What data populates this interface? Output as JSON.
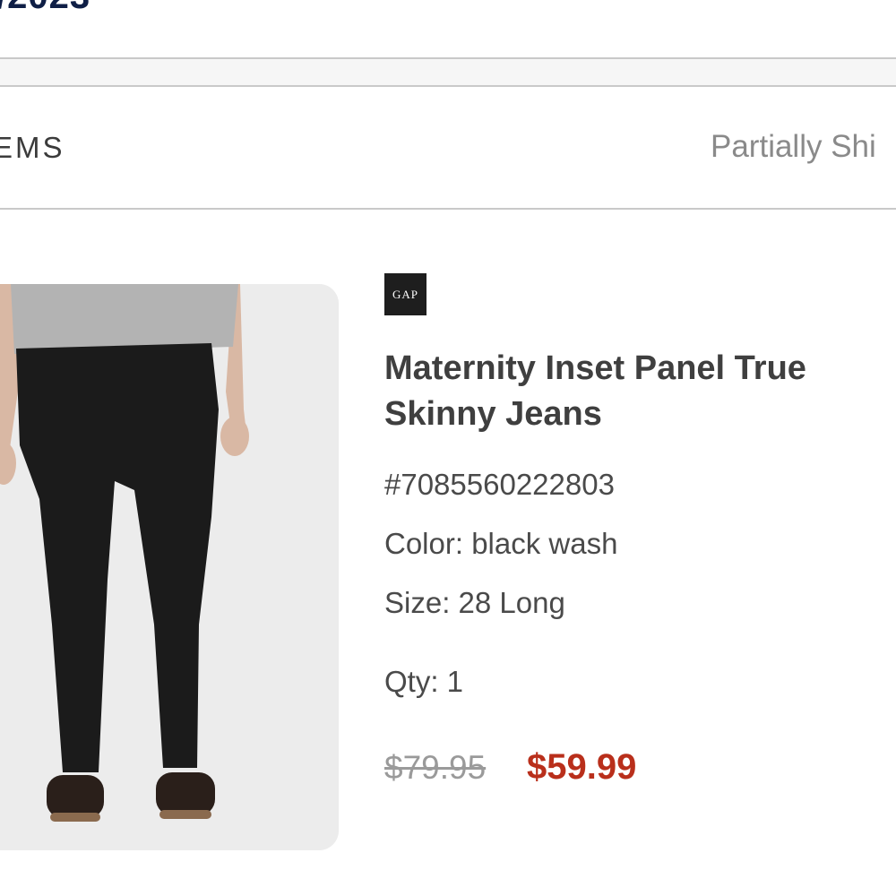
{
  "header": {
    "date_fragment": "/2023"
  },
  "section": {
    "items_label": "EMS",
    "status": "Partially Shi"
  },
  "product": {
    "brand": "GAP",
    "title": "Maternity Inset Panel True Skinny Jeans",
    "sku": "#7085560222803",
    "color": "Color: black wash",
    "size": "Size: 28 Long",
    "qty": "Qty: 1",
    "original_price": "$79.95",
    "sale_price": "$59.99",
    "image_icon": "product-photo-jeans"
  },
  "colors": {
    "sale": "#b92f1b",
    "brand_bg": "#1e1e1e",
    "navy": "#0f1f46"
  }
}
